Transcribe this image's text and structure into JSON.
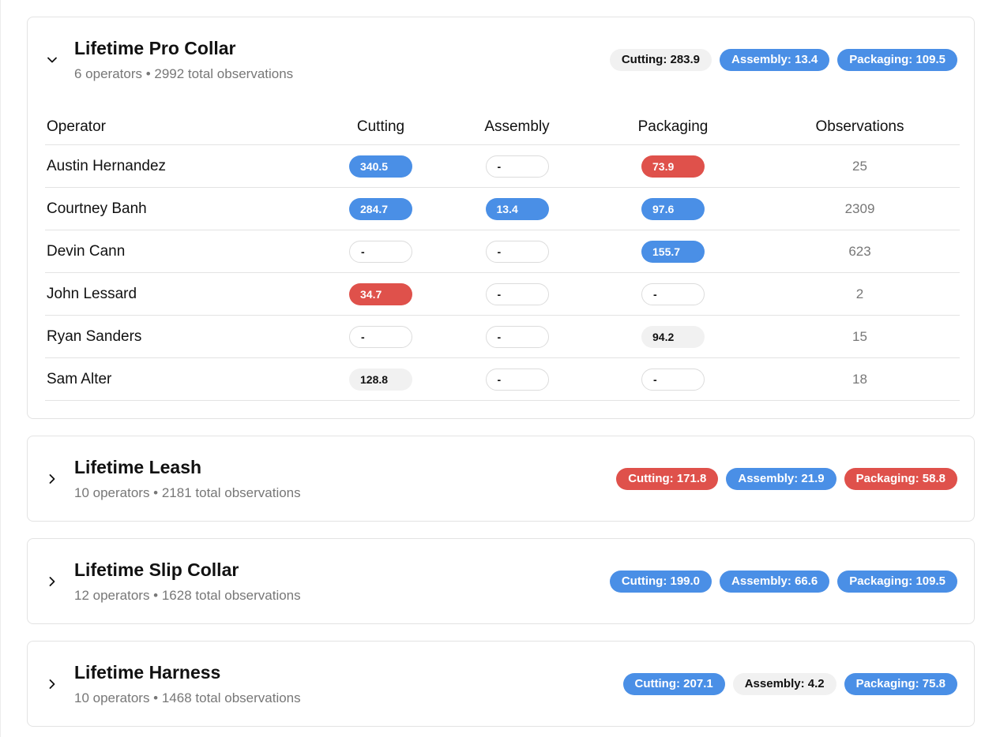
{
  "products": [
    {
      "name": "Lifetime Pro Collar",
      "summary": "6 operators • 2992 total observations",
      "expanded": true,
      "badges": [
        {
          "label": "Cutting: 283.9",
          "status": "neutral"
        },
        {
          "label": "Assembly: 13.4",
          "status": "good"
        },
        {
          "label": "Packaging: 109.5",
          "status": "good"
        }
      ],
      "table": {
        "headers": [
          "Operator",
          "Cutting",
          "Assembly",
          "Packaging",
          "Observations"
        ],
        "rows": [
          {
            "operator": "Austin Hernandez",
            "cutting": {
              "value": "340.5",
              "status": "good"
            },
            "assembly": {
              "value": "-",
              "status": "empty"
            },
            "packaging": {
              "value": "73.9",
              "status": "bad"
            },
            "observations": "25"
          },
          {
            "operator": "Courtney Banh",
            "cutting": {
              "value": "284.7",
              "status": "good"
            },
            "assembly": {
              "value": "13.4",
              "status": "good"
            },
            "packaging": {
              "value": "97.6",
              "status": "good"
            },
            "observations": "2309"
          },
          {
            "operator": "Devin Cann",
            "cutting": {
              "value": "-",
              "status": "empty"
            },
            "assembly": {
              "value": "-",
              "status": "empty"
            },
            "packaging": {
              "value": "155.7",
              "status": "good"
            },
            "observations": "623"
          },
          {
            "operator": "John Lessard",
            "cutting": {
              "value": "34.7",
              "status": "bad"
            },
            "assembly": {
              "value": "-",
              "status": "empty"
            },
            "packaging": {
              "value": "-",
              "status": "empty"
            },
            "observations": "2"
          },
          {
            "operator": "Ryan Sanders",
            "cutting": {
              "value": "-",
              "status": "empty"
            },
            "assembly": {
              "value": "-",
              "status": "empty"
            },
            "packaging": {
              "value": "94.2",
              "status": "neutral"
            },
            "observations": "15"
          },
          {
            "operator": "Sam Alter",
            "cutting": {
              "value": "128.8",
              "status": "neutral"
            },
            "assembly": {
              "value": "-",
              "status": "empty"
            },
            "packaging": {
              "value": "-",
              "status": "empty"
            },
            "observations": "18"
          }
        ]
      }
    },
    {
      "name": "Lifetime Leash",
      "summary": "10 operators • 2181 total observations",
      "expanded": false,
      "badges": [
        {
          "label": "Cutting: 171.8",
          "status": "bad"
        },
        {
          "label": "Assembly: 21.9",
          "status": "good"
        },
        {
          "label": "Packaging: 58.8",
          "status": "bad"
        }
      ]
    },
    {
      "name": "Lifetime Slip Collar",
      "summary": "12 operators • 1628 total observations",
      "expanded": false,
      "badges": [
        {
          "label": "Cutting: 199.0",
          "status": "good"
        },
        {
          "label": "Assembly: 66.6",
          "status": "good"
        },
        {
          "label": "Packaging: 109.5",
          "status": "good"
        }
      ]
    },
    {
      "name": "Lifetime Harness",
      "summary": "10 operators • 1468 total observations",
      "expanded": false,
      "badges": [
        {
          "label": "Cutting: 207.1",
          "status": "good"
        },
        {
          "label": "Assembly: 4.2",
          "status": "neutral"
        },
        {
          "label": "Packaging: 75.8",
          "status": "good"
        }
      ]
    }
  ],
  "colors": {
    "good": "#4a8fe6",
    "bad": "#df514b",
    "neutral": "#f1f1f1"
  },
  "icons": {
    "expanded": "chevron-down-icon",
    "collapsed": "chevron-right-icon"
  }
}
